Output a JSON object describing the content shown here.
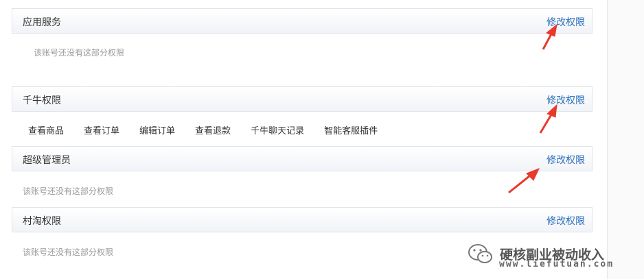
{
  "sections": [
    {
      "title": "应用服务",
      "edit_label": "修改权限",
      "empty_text": "该账号还没有这部分权限"
    },
    {
      "title": "千牛权限",
      "edit_label": "修改权限",
      "permissions": [
        "查看商品",
        "查看订单",
        "编辑订单",
        "查看退款",
        "千牛聊天记录",
        "智能客服插件"
      ]
    },
    {
      "title": "超级管理员",
      "edit_label": "修改权限",
      "empty_text": "该账号还没有这部分权限"
    },
    {
      "title": "村淘权限",
      "edit_label": "修改权限",
      "empty_text": "该账号还没有这部分权限"
    }
  ],
  "watermark": {
    "name": "硬核副业被动收入",
    "url": "www.liefutuan.com"
  },
  "colors": {
    "link": "#2a6ebb",
    "arrow": "#e8392b",
    "muted_text": "#999999"
  }
}
